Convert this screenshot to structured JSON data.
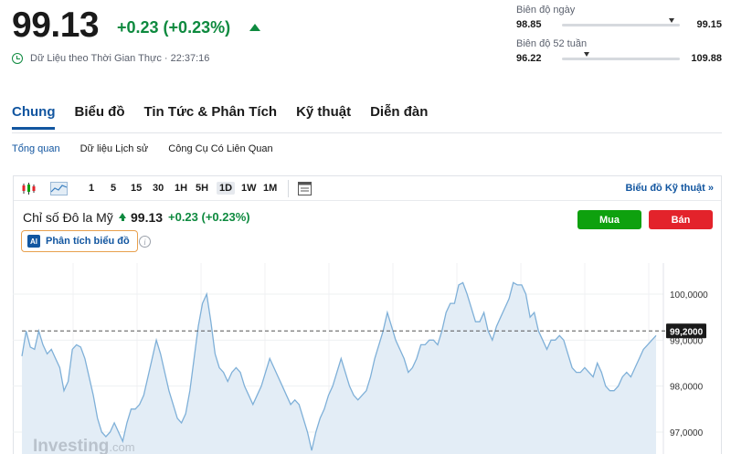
{
  "quote": {
    "price": "99.13",
    "change": "+0.23 (+0.23%)",
    "realtime": "Dữ Liệu theo Thời Gian Thực · 22:37:16",
    "up_color": "#0e8a3f"
  },
  "ranges": {
    "day": {
      "label": "Biên độ ngày",
      "low": "98.85",
      "high": "99.15",
      "position": 0.93
    },
    "week52": {
      "label": "Biên độ 52 tuần",
      "low": "96.22",
      "high": "109.88",
      "position": 0.21
    }
  },
  "tabs": [
    "Chung",
    "Biểu đồ",
    "Tin Tức & Phân Tích",
    "Kỹ thuật",
    "Diễn đàn"
  ],
  "subtabs": [
    "Tổng quan",
    "Dữ liệu Lịch sử",
    "Công Cụ Có Liên Quan"
  ],
  "toolbar": {
    "intervals": [
      "1",
      "5",
      "15",
      "30",
      "1H",
      "5H",
      "1D",
      "1W",
      "1M"
    ],
    "active_interval": "1D",
    "tech_chart_link": "Biểu đồ Kỹ thuật »"
  },
  "instrument": {
    "name": "Chỉ số Đô la Mỹ",
    "price": "99.13",
    "change": "+0.23 (+0.23%)",
    "ai_badge": "AI",
    "ai_label": "Phân tích biểu đồ",
    "info_glyph": "i"
  },
  "actions": {
    "buy": "Mua",
    "sell": "Bán"
  },
  "watermark": {
    "brand": "Investing",
    "suffix": ".com"
  },
  "chart_data": {
    "type": "area",
    "ylim": [
      96.5,
      100.6
    ],
    "y_ticks": [
      "100,0000",
      "99,0000",
      "98,0000",
      "97,0000"
    ],
    "y_tick_values": [
      100,
      99,
      98,
      97
    ],
    "current_value": 99.2,
    "current_label": "99,2000",
    "line_color": "#7fb0d8",
    "fill_color": "#e3edf6",
    "values": [
      98.65,
      99.2,
      98.85,
      98.8,
      99.2,
      98.9,
      98.7,
      98.8,
      98.6,
      98.4,
      97.9,
      98.1,
      98.8,
      98.9,
      98.85,
      98.6,
      98.2,
      97.8,
      97.3,
      97.0,
      96.9,
      97.0,
      97.2,
      97.0,
      96.8,
      97.2,
      97.5,
      97.5,
      97.6,
      97.8,
      98.2,
      98.6,
      99.0,
      98.7,
      98.3,
      97.9,
      97.6,
      97.3,
      97.2,
      97.4,
      97.9,
      98.6,
      99.3,
      99.8,
      100.0,
      99.4,
      98.7,
      98.4,
      98.3,
      98.1,
      98.3,
      98.4,
      98.3,
      98.0,
      97.8,
      97.6,
      97.8,
      98.0,
      98.3,
      98.6,
      98.4,
      98.2,
      98.0,
      97.8,
      97.6,
      97.7,
      97.6,
      97.3,
      97.0,
      96.6,
      97.0,
      97.3,
      97.5,
      97.8,
      98.0,
      98.3,
      98.6,
      98.3,
      98.0,
      97.8,
      97.7,
      97.8,
      97.9,
      98.2,
      98.6,
      98.9,
      99.2,
      99.6,
      99.3,
      99.0,
      98.8,
      98.6,
      98.3,
      98.4,
      98.6,
      98.9,
      98.9,
      99.0,
      99.0,
      98.9,
      99.2,
      99.6,
      99.8,
      99.8,
      100.2,
      100.25,
      100.0,
      99.7,
      99.4,
      99.4,
      99.6,
      99.2,
      99.0,
      99.3,
      99.5,
      99.7,
      99.9,
      100.25,
      100.2,
      100.2,
      100.0,
      99.5,
      99.6,
      99.2,
      99.0,
      98.8,
      99.0,
      99.0,
      99.1,
      99.0,
      98.7,
      98.4,
      98.3,
      98.3,
      98.4,
      98.3,
      98.2,
      98.5,
      98.3,
      98.0,
      97.9,
      97.9,
      98.0,
      98.2,
      98.3,
      98.2,
      98.4,
      98.6,
      98.8,
      98.9,
      99.0,
      99.1
    ]
  }
}
